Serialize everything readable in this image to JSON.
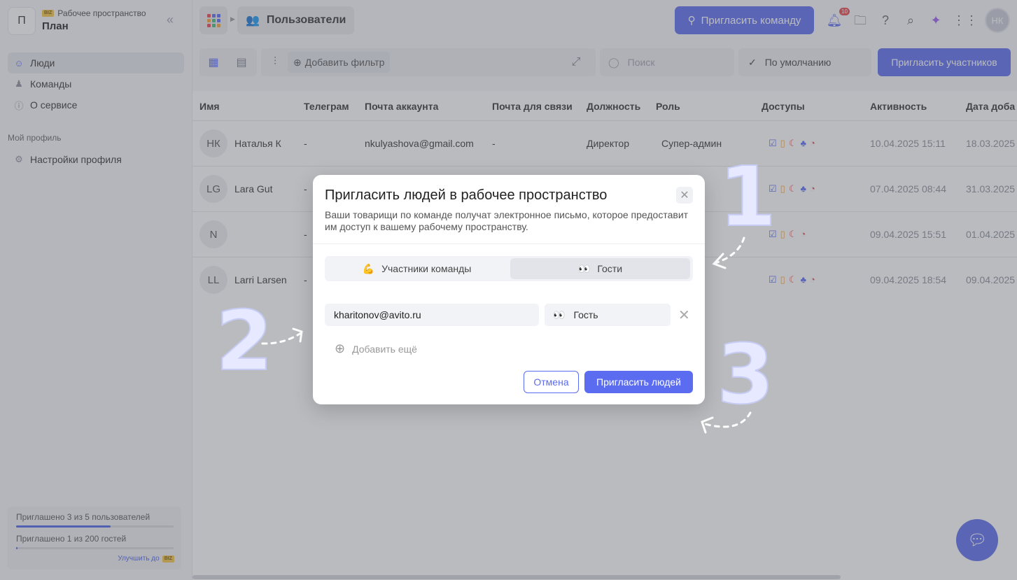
{
  "sidebar": {
    "workspace_initial": "П",
    "workspace_label": "Рабочее пространство",
    "workspace_badge": "BIZ",
    "workspace_name": "План",
    "nav": [
      {
        "label": "Люди",
        "icon": "smile-icon",
        "active": true
      },
      {
        "label": "Команды",
        "icon": "team-icon",
        "active": false
      },
      {
        "label": "О сервисе",
        "icon": "info-icon",
        "active": false
      }
    ],
    "profile_section_title": "Мой профиль",
    "profile_settings_label": "Настройки профиля",
    "quota": {
      "users_text": "Приглашено 3 из 5 пользователей",
      "users_progress": 0.6,
      "guests_text": "Приглашено 1 из 200 гостей",
      "guests_progress": 0.005,
      "upgrade_label": "Улучшить до",
      "upgrade_badge": "BIZ"
    }
  },
  "topbar": {
    "breadcrumb": "Пользователи",
    "invite_team_label": "Пригласить команду",
    "notifications_count": "10",
    "user_initials": "НК"
  },
  "toolbar": {
    "add_filter_label": "Добавить фильтр",
    "search_placeholder": "Поиск",
    "sort_label": "По умолчанию",
    "invite_members_label": "Пригласить участников"
  },
  "table": {
    "columns": [
      "Имя",
      "Телеграм",
      "Почта аккаунта",
      "Почта для связи",
      "Должность",
      "Роль",
      "Доступы",
      "Активность",
      "Дата доба"
    ],
    "rows": [
      {
        "initials": "НК",
        "name": "Наталья К",
        "telegram": "-",
        "email": "nkulyashova@gmail.com",
        "contact": "-",
        "position": "Директор",
        "role": "Супер-админ",
        "activity": "10.04.2025 15:11",
        "added": "18.03.2025"
      },
      {
        "initials": "LG",
        "name": "Lara Gut",
        "telegram": "-",
        "email": "",
        "contact": "",
        "position": "",
        "role": "",
        "activity": "07.04.2025 08:44",
        "added": "31.03.2025"
      },
      {
        "initials": "N",
        "name": "",
        "telegram": "-",
        "email": "",
        "contact": "",
        "position": "",
        "role": "",
        "activity": "09.04.2025 15:51",
        "added": "01.04.2025"
      },
      {
        "initials": "LL",
        "name": "Larri Larsen",
        "telegram": "-",
        "email": "",
        "contact": "",
        "position": "",
        "role": "",
        "activity": "09.04.2025 18:54",
        "added": "09.04.2025"
      }
    ]
  },
  "annotations": [
    "1",
    "2",
    "3"
  ],
  "modal": {
    "title": "Пригласить людей в рабочее пространство",
    "description": "Ваши товарищи по команде получат электронное письмо, которое предоставит им доступ к вашему рабочему пространству.",
    "tabs": [
      {
        "label": "Участники команды",
        "emoji": "💪",
        "selected": false
      },
      {
        "label": "Гости",
        "emoji": "👀",
        "selected": true
      }
    ],
    "email_value": "kharitonov@avito.ru",
    "role_emoji": "👀",
    "role_value": "Гость",
    "add_more_label": "Добавить ещё",
    "cancel_label": "Отмена",
    "submit_label": "Пригласить людей"
  },
  "colors": {
    "accent": "#5b6cf0",
    "badge": "#f3c544",
    "notification": "#e5484d"
  }
}
